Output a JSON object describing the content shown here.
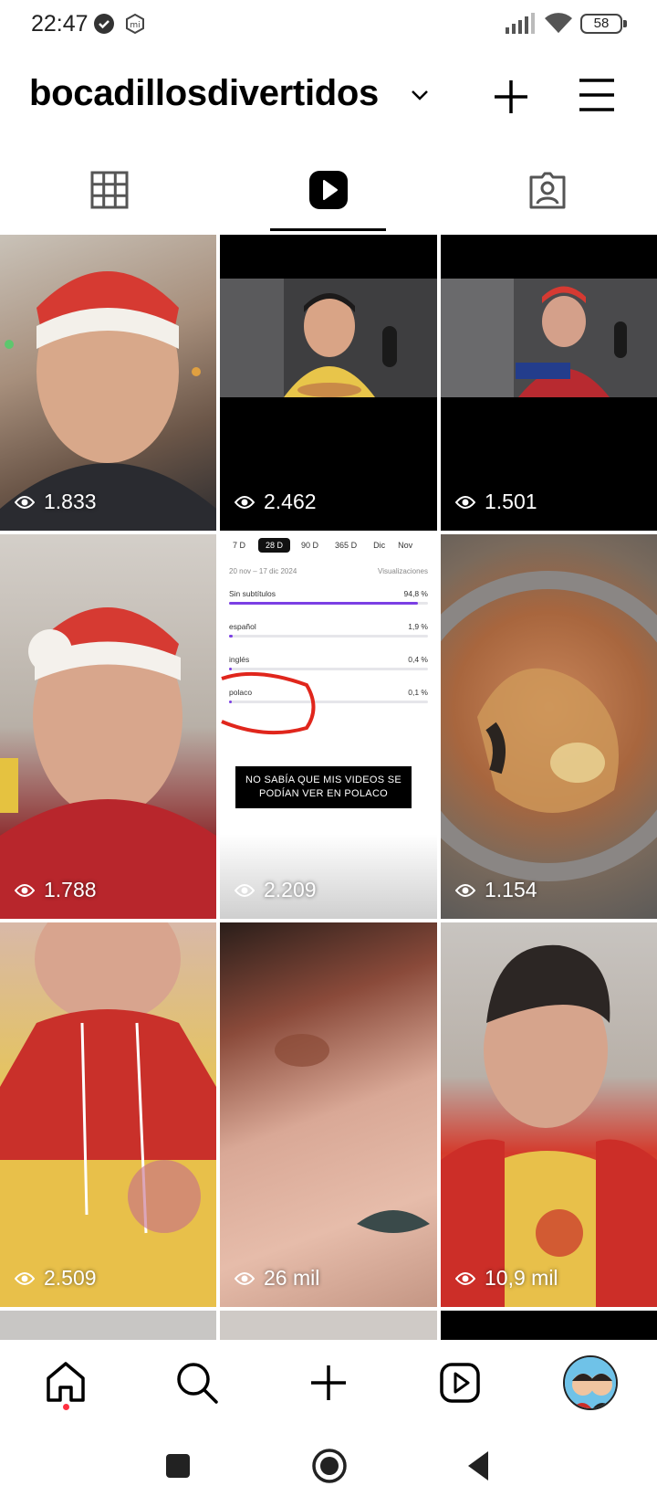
{
  "status_bar": {
    "time": "22:47",
    "battery": "58",
    "icons": [
      "check-circle-icon",
      "mi-icon",
      "signal-icon",
      "wifi-icon",
      "battery-icon"
    ]
  },
  "header": {
    "username": "bocadillosdivertidos",
    "icons": [
      "chevron-down-icon",
      "plus-icon",
      "menu-icon"
    ]
  },
  "tabs": [
    {
      "name": "grid",
      "icon": "grid-icon",
      "active": false
    },
    {
      "name": "reels",
      "icon": "reels-icon",
      "active": true
    },
    {
      "name": "tagged",
      "icon": "tagged-icon",
      "active": false
    }
  ],
  "reels": [
    {
      "views": "1.833"
    },
    {
      "views": "2.462"
    },
    {
      "views": "1.501"
    },
    {
      "views": "1.788"
    },
    {
      "views": "2.209"
    },
    {
      "views": "1.154"
    },
    {
      "views": "2.509"
    },
    {
      "views": "26 mil"
    },
    {
      "views": "10,9 mil"
    }
  ],
  "analytics_thumb": {
    "ranges": [
      "7 D",
      "28 D",
      "90 D",
      "365 D",
      "Dic",
      "Nov"
    ],
    "date_range": "20 nov – 17 dic 2024",
    "column_label": "Visualizaciones",
    "rows": [
      {
        "label": "Sin subtítulos",
        "value": "94,8 %",
        "fraction": 0.948
      },
      {
        "label": "español",
        "value": "1,9 %",
        "fraction": 0.019
      },
      {
        "label": "inglés",
        "value": "0,4 %",
        "fraction": 0.004
      },
      {
        "label": "polaco",
        "value": "0,1 %",
        "fraction": 0.001
      }
    ],
    "caption_line1": "NO SABÍA QUE MIS VIDEOS SE",
    "caption_line2": "PODÍAN VER EN POLACO"
  },
  "bottom_nav": {
    "items": [
      "home-icon",
      "search-icon",
      "create-icon",
      "reels-icon",
      "profile-avatar"
    ]
  },
  "colors": {
    "accent_red": "#ff3040",
    "purple_bar": "#7b3fe4"
  }
}
